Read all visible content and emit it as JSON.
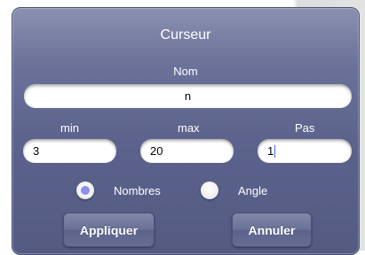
{
  "dialog": {
    "title": "Curseur",
    "name_label": "Nom",
    "name_value": "n",
    "min_label": "min",
    "min_value": "3",
    "max_label": "max",
    "max_value": "20",
    "step_label": "Pas",
    "step_value": "1",
    "radio_numbers_label": "Nombres",
    "radio_angle_label": "Angle",
    "radio_selected": "Nombres",
    "apply_label": "Appliquer",
    "cancel_label": "Annuler"
  },
  "colors": {
    "dialog_top": "#8a91af",
    "dialog_bottom": "#545b83",
    "radio_selected_dot": "#8c8fea"
  }
}
